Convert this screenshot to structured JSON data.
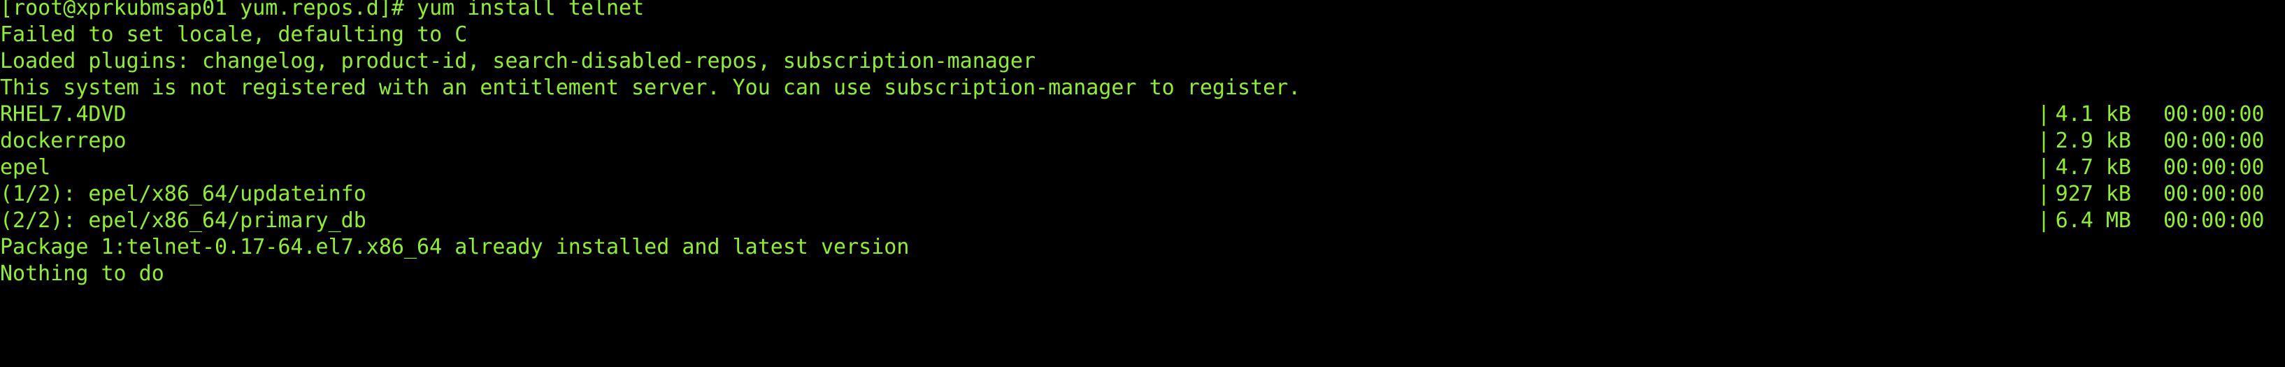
{
  "terminal": {
    "prompt": "[root@xprkubmsap01 yum.repos.d]# yum install telnet",
    "messages": [
      "Failed to set locale, defaulting to C",
      "Loaded plugins: changelog, product-id, search-disabled-repos, subscription-manager",
      "This system is not registered with an entitlement server. You can use subscription-manager to register."
    ],
    "downloads": [
      {
        "name": "RHEL7.4DVD",
        "separator": "|",
        "size": "4.1 kB",
        "time": "00:00:00"
      },
      {
        "name": "dockerrepo",
        "separator": "|",
        "size": "2.9 kB",
        "time": "00:00:00"
      },
      {
        "name": "epel",
        "separator": "|",
        "size": "4.7 kB",
        "time": "00:00:00"
      },
      {
        "name": "(1/2): epel/x86_64/updateinfo",
        "separator": "|",
        "size": "927 kB",
        "time": "00:00:00"
      },
      {
        "name": "(2/2): epel/x86_64/primary_db",
        "separator": "|",
        "size": "6.4 MB",
        "time": "00:00:00"
      }
    ],
    "result_lines": [
      "Package 1:telnet-0.17-64.el7.x86_64 already installed and latest version",
      "Nothing to do"
    ],
    "colors": {
      "background": "#000000",
      "text": "#8ef02b"
    }
  }
}
